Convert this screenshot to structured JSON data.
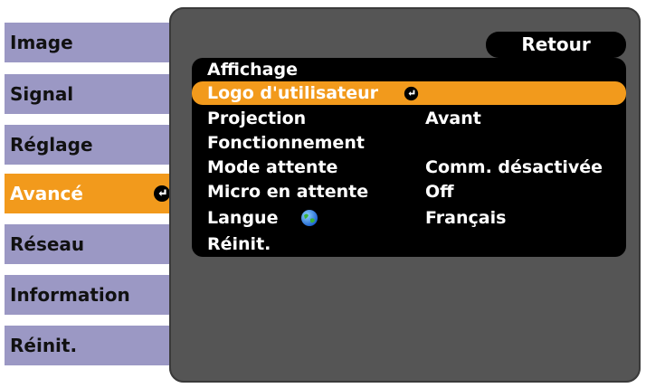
{
  "tabs": [
    {
      "label": "Image",
      "active": false
    },
    {
      "label": "Signal",
      "active": false
    },
    {
      "label": "Réglage",
      "active": false
    },
    {
      "label": "Avancé",
      "active": true
    },
    {
      "label": "Réseau",
      "active": false
    },
    {
      "label": "Information",
      "active": false
    },
    {
      "label": "Réinit.",
      "active": false
    }
  ],
  "header": {
    "back_label": "Retour"
  },
  "menu": {
    "items": [
      {
        "label": "Affichage",
        "value": ""
      },
      {
        "label": "Logo d'utilisateur",
        "value": "",
        "selected": true,
        "icon": "enter-icon"
      },
      {
        "label": "Projection",
        "value": "Avant"
      },
      {
        "label": "Fonctionnement",
        "value": ""
      },
      {
        "label": "Mode attente",
        "value": "Comm. désactivée"
      },
      {
        "label": "Micro en attente",
        "value": "Off"
      },
      {
        "label": "Langue",
        "value": "Français",
        "icon": "globe-icon"
      },
      {
        "label": "Réinit.",
        "value": ""
      }
    ]
  },
  "colors": {
    "accent": "#f29a1c",
    "tab": "#9b98c4",
    "panel": "#555555",
    "menu": "#000000"
  }
}
